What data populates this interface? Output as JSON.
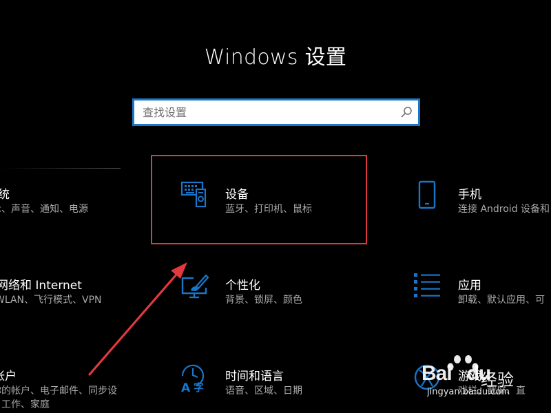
{
  "window": {
    "title": "Windows 设置"
  },
  "search": {
    "placeholder": "查找设置",
    "value": ""
  },
  "tiles": [
    {
      "name": "系统",
      "desc": "示、声音、通知、电源",
      "icon": "laptop-icon"
    },
    {
      "name": "设备",
      "desc": "蓝牙、打印机、鼠标",
      "icon": "devices-icon"
    },
    {
      "name": "手机",
      "desc": "连接 Android 设备和",
      "icon": "phone-icon"
    },
    {
      "name": "网络和 Internet",
      "desc": "WLAN、飞行模式、VPN",
      "icon": "globe-icon"
    },
    {
      "name": "个性化",
      "desc": "背景、锁屏、颜色",
      "icon": "paintbrush-icon"
    },
    {
      "name": "应用",
      "desc": "卸载、默认应用、可",
      "icon": "apps-list-icon"
    },
    {
      "name": "帐户",
      "desc": "你的帐户、电子邮件、同步设",
      "desc2": "、工作、家庭",
      "icon": "person-icon"
    },
    {
      "name": "时间和语言",
      "desc": "语音、区域、日期",
      "icon": "time-language-icon"
    },
    {
      "name": "游戏",
      "desc": "戏栏、截屏、直",
      "icon": "xbox-icon"
    }
  ],
  "watermark": {
    "brand": "Bai",
    "brand_suffix": "du",
    "product": "经验",
    "url": "jingyan.baidu.com"
  },
  "colors": {
    "accent": "#1976c9",
    "highlight": "#e0393e",
    "background": "#000000",
    "text": "#ffffff",
    "subtext": "#a9a9a9"
  }
}
